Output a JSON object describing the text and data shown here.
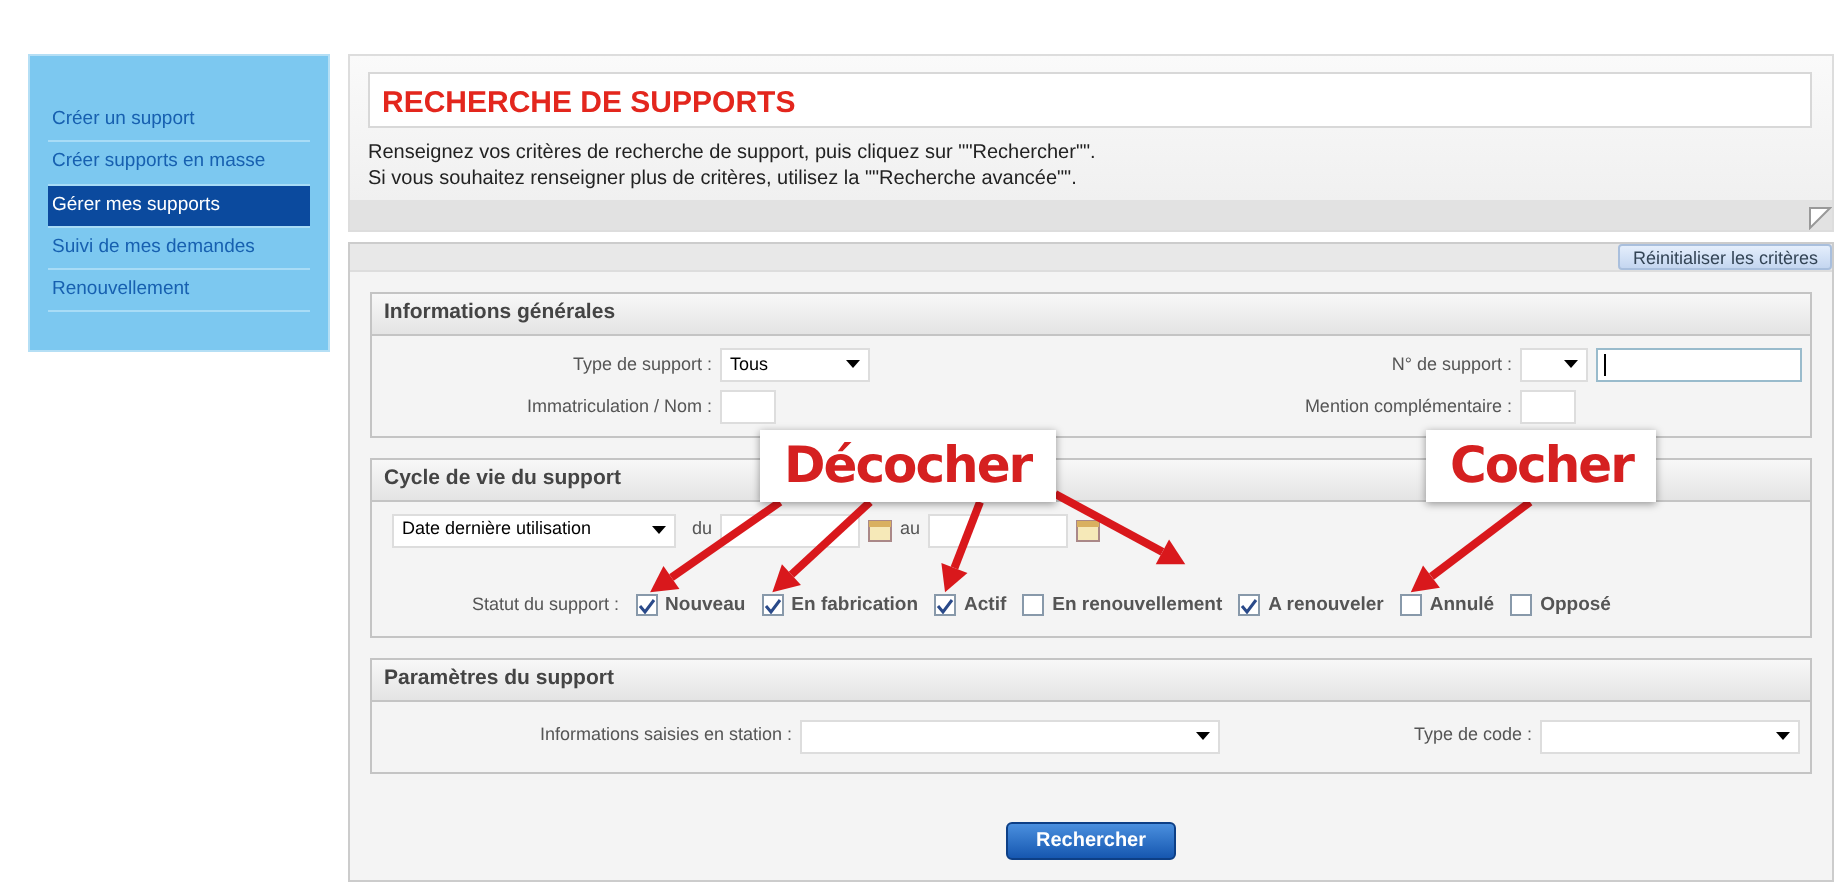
{
  "sidebar": {
    "items": [
      {
        "label": "Créer un support",
        "selected": false
      },
      {
        "label": "Créer supports en masse",
        "selected": false
      },
      {
        "label": "Gérer mes supports",
        "selected": true
      },
      {
        "label": "Suivi de mes demandes",
        "selected": false
      },
      {
        "label": "Renouvellement",
        "selected": false
      }
    ]
  },
  "header": {
    "title": "RECHERCHE DE SUPPORTS",
    "instructions": [
      "Renseignez vos critères de recherche de support, puis cliquez sur \"\"Rechercher\"\".",
      "Si vous souhaitez renseigner plus de critères, utilisez la \"\"Recherche avancée\"\"."
    ]
  },
  "reset_button": "Réinitialiser les critères",
  "sections": [
    {
      "title": "Informations générales",
      "fields": [
        {
          "kind": "select",
          "label": "Type de support :",
          "value": "Tous"
        },
        {
          "kind": "select-input",
          "label": "N° de support :"
        },
        {
          "kind": "input",
          "label": "Immatriculation / Nom :"
        },
        {
          "kind": "input",
          "label": "Mention complémentaire :"
        }
      ]
    },
    {
      "title": "Cycle de vie du support",
      "fields": [
        {
          "kind": "date-range",
          "value": "Date dernière utilisation",
          "from_label": "du",
          "to_label": "au"
        },
        {
          "kind": "checkboxes",
          "label": "Statut du support :",
          "options": [
            {
              "label": "Nouveau",
              "checked": true
            },
            {
              "label": "En fabrication",
              "checked": true
            },
            {
              "label": "Actif",
              "checked": true
            },
            {
              "label": "En renouvellement",
              "checked": false
            },
            {
              "label": "A renouveler",
              "checked": true
            },
            {
              "label": "Annulé",
              "checked": false
            },
            {
              "label": "Opposé",
              "checked": false
            }
          ]
        }
      ]
    },
    {
      "title": "Paramètres du support",
      "fields": [
        {
          "kind": "wide-select",
          "label": "Informations saisies en station :"
        },
        {
          "kind": "wide-select",
          "label": "Type de code :"
        }
      ]
    }
  ],
  "search_button": "Rechercher",
  "annotations": [
    {
      "label": "Décocher"
    },
    {
      "label": "Cocher"
    }
  ]
}
